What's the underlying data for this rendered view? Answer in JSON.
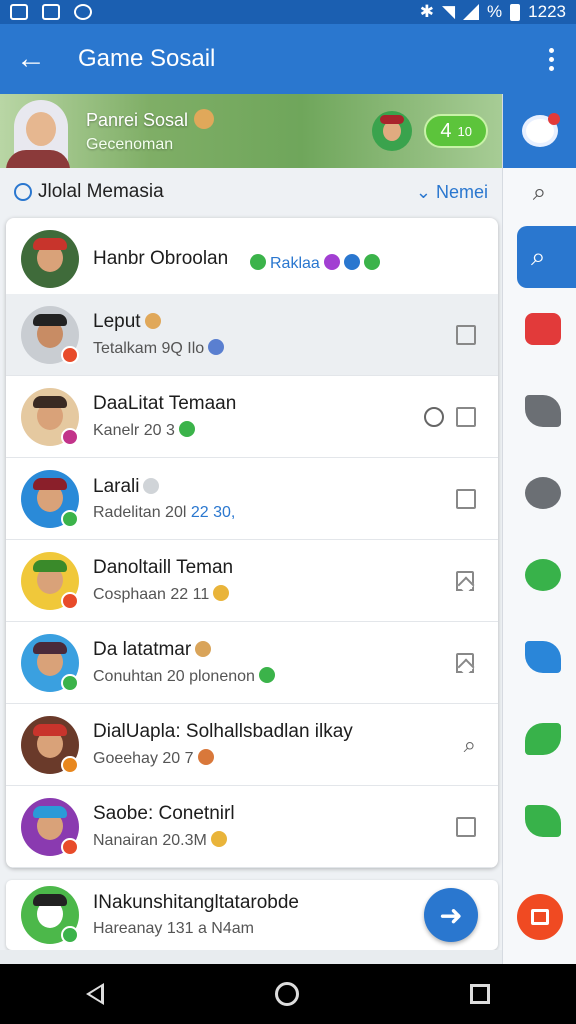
{
  "status": {
    "time": "1223",
    "battery_label": "%"
  },
  "appbar": {
    "title": "Game Sosail"
  },
  "banner": {
    "name": "Panrei Sosal",
    "subtitle": "Gecenoman",
    "score_main": "4",
    "score_suffix": "10"
  },
  "section": {
    "title": "Jlolal Memasia",
    "link": "Nemei"
  },
  "chats": [
    {
      "title": "Hanbr Obroolan",
      "tagline": "Raklaa",
      "subtitle": ""
    },
    {
      "title": "Leput",
      "subtitle": "Tetalkam 9Q Ilo",
      "highlight": ""
    },
    {
      "title": "DaaLitat Temaan",
      "subtitle": "Kanelr 20 3",
      "highlight": ""
    },
    {
      "title": "Larali",
      "subtitle": "Radelitan 20l",
      "highlight": "22 30,"
    },
    {
      "title": "Danoltaill Teman",
      "subtitle": "Cosphaan 22 11",
      "highlight": ""
    },
    {
      "title": "Da latatmar",
      "subtitle": "Conuhtan 20 plonenon",
      "highlight": ""
    },
    {
      "title": "DialUapla: Solhallsbadlan ilkay",
      "subtitle": "Goeehay 20 7",
      "highlight": ""
    },
    {
      "title": "Saobe: Conetnirl",
      "subtitle": "Nanairan 20.3M",
      "highlight": ""
    }
  ],
  "peek": {
    "title": "INakunshitangltatarobde",
    "subtitle": "Hareanay 131 a N4am"
  },
  "colors": {
    "primary": "#2a77cf",
    "status_bar": "#1b5fb1",
    "accent_green": "#5cc43b",
    "fab_red": "#f04a22"
  }
}
